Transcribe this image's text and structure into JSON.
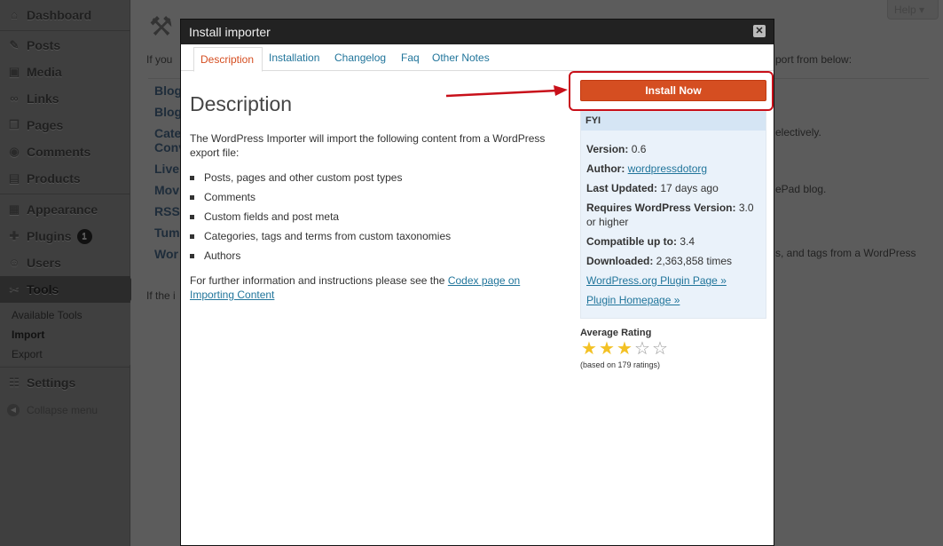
{
  "sidebar": {
    "items": [
      {
        "label": "Dashboard",
        "icon": "dashboard-icon"
      },
      {
        "label": "Posts",
        "icon": "posts-icon"
      },
      {
        "label": "Media",
        "icon": "media-icon"
      },
      {
        "label": "Links",
        "icon": "links-icon"
      },
      {
        "label": "Pages",
        "icon": "pages-icon"
      },
      {
        "label": "Comments",
        "icon": "comments-icon"
      },
      {
        "label": "Products",
        "icon": "products-icon"
      },
      {
        "label": "Appearance",
        "icon": "appearance-icon"
      },
      {
        "label": "Plugins",
        "icon": "plugins-icon",
        "badge": "1"
      },
      {
        "label": "Users",
        "icon": "users-icon"
      },
      {
        "label": "Tools",
        "icon": "tools-icon"
      },
      {
        "label": "Settings",
        "icon": "settings-icon"
      }
    ],
    "tools_submenu": [
      "Available Tools",
      "Import",
      "Export"
    ],
    "collapse_label": "Collapse menu"
  },
  "help_label": "Help",
  "background": {
    "intro_fragment": "If you",
    "intro_end": "port from below:",
    "footer_fragment": "If the i",
    "rows": [
      "Blog",
      "Blog",
      "Cate",
      "Conv",
      "Live",
      "Mov",
      "RSS",
      "Tum",
      "Wor"
    ],
    "row_text": [
      "electively.",
      "ePad blog.",
      "s, and tags from a WordPress"
    ]
  },
  "modal": {
    "title": "Install importer",
    "close_icon": "close-icon",
    "tabs": [
      "Description",
      "Installation",
      "Changelog",
      "Faq",
      "Other Notes"
    ],
    "active_tab": "Description",
    "heading": "Description",
    "intro": "The WordPress Importer will import the following content from a WordPress export file:",
    "bullets": [
      "Posts, pages and other custom post types",
      "Comments",
      "Custom fields and post meta",
      "Categories, tags and terms from custom taxonomies",
      "Authors"
    ],
    "further_text": "For further information and instructions please see the ",
    "further_link": "Codex page on Importing Content",
    "install_button": "Install Now",
    "fyi": {
      "title": "FYI",
      "version_label": "Version:",
      "version": "0.6",
      "author_label": "Author:",
      "author": "wordpressdotorg",
      "updated_label": "Last Updated:",
      "updated": "17 days ago",
      "requires_label": "Requires WordPress Version:",
      "requires": "3.0 or higher",
      "compatible_label": "Compatible up to:",
      "compatible": "3.4",
      "downloaded_label": "Downloaded:",
      "downloaded": "2,363,858 times",
      "plugin_page_link": "WordPress.org Plugin Page »",
      "homepage_link": "Plugin Homepage »"
    },
    "rating": {
      "title": "Average Rating",
      "stars": 3,
      "max": 5,
      "count_text": "(based on 179 ratings)"
    }
  },
  "colors": {
    "accent": "#d54e21",
    "link": "#21759b",
    "highlight_box": "#c8101a",
    "star": "#f3c124"
  }
}
